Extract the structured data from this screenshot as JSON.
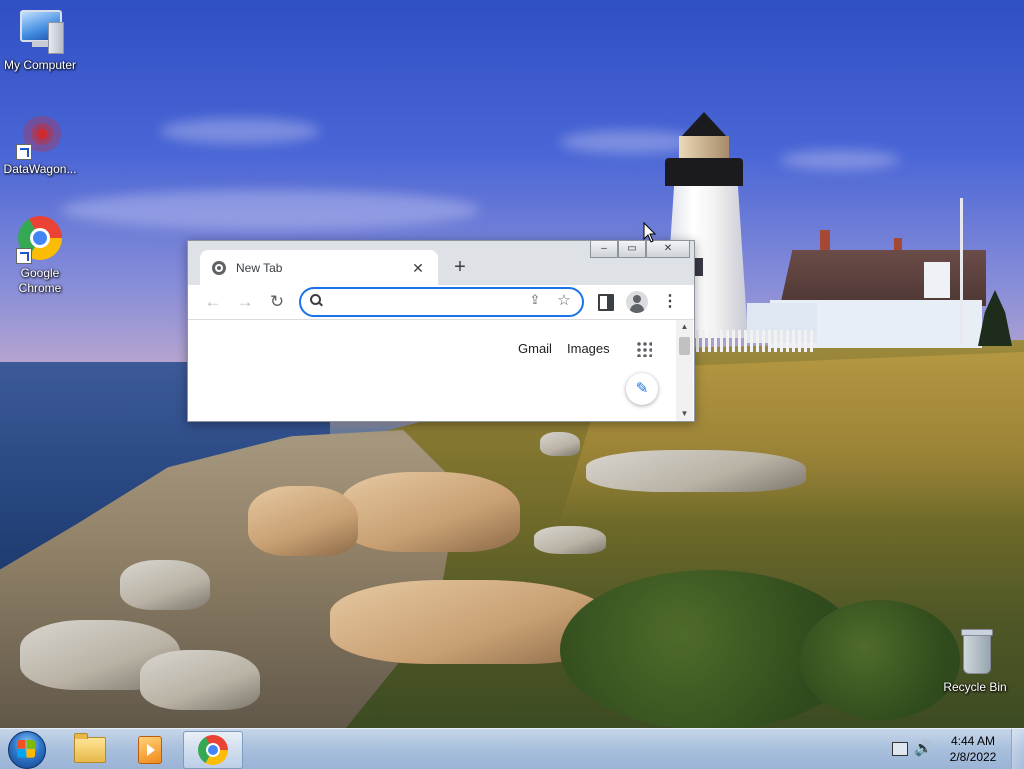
{
  "desktop": {
    "icons": [
      {
        "label": "My Computer",
        "icon": "my-computer-icon"
      },
      {
        "label": "DataWagon...",
        "icon": "datawagon-icon"
      },
      {
        "label": "Google Chrome",
        "icon": "chrome-icon"
      },
      {
        "label": "Recycle Bin",
        "icon": "recycle-bin-icon"
      }
    ]
  },
  "browser": {
    "tab": {
      "title": "New Tab",
      "close": "✕"
    },
    "new_tab": "+",
    "window_controls": {
      "minimize": "–",
      "maximize": "▭",
      "close": "✕"
    },
    "toolbar": {
      "back": "←",
      "forward": "→",
      "reload": "↻",
      "share": "⇪",
      "bookmark": "☆",
      "menu": "⋮"
    },
    "omnibox": {
      "value": "",
      "placeholder": ""
    },
    "ntp": {
      "gmail": "Gmail",
      "images": "Images",
      "edit": "✎"
    },
    "scrollbar": {
      "up": "▲",
      "down": "▼"
    }
  },
  "taskbar": {
    "apps": [
      {
        "name": "Windows Explorer",
        "icon": "folder-icon",
        "active": false
      },
      {
        "name": "Windows Media Player",
        "icon": "media-player-icon",
        "active": false
      },
      {
        "name": "Google Chrome",
        "icon": "chrome-icon",
        "active": true
      }
    ],
    "tray": {
      "volume": "🔊"
    },
    "clock": {
      "time": "4:44 AM",
      "date": "2/8/2022"
    }
  },
  "colors": {
    "accent": "#1a73e8",
    "taskbar": "#a8bfdc"
  }
}
